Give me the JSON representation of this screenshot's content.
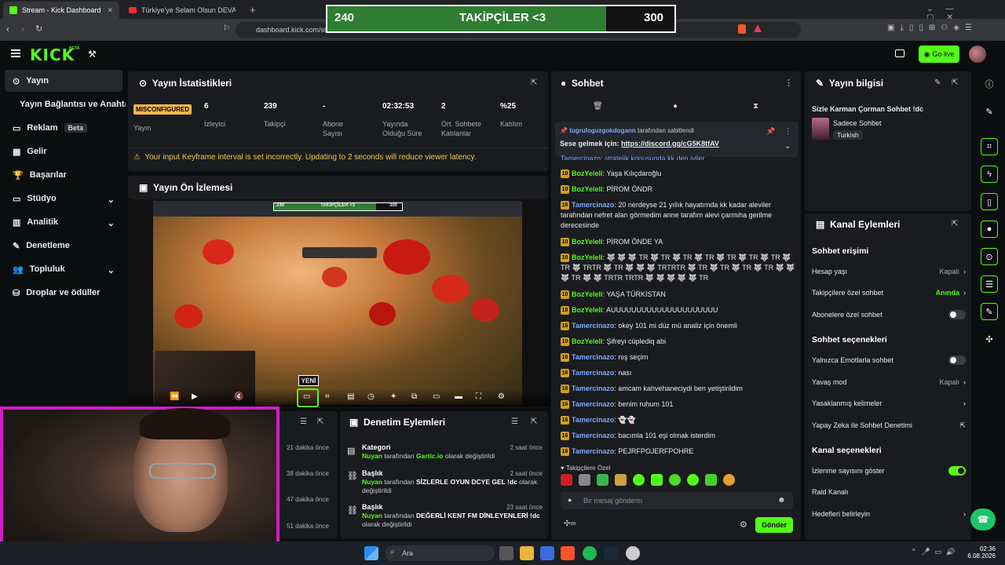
{
  "browser": {
    "tabs": [
      {
        "label": "Stream - Kick Dashboard"
      },
      {
        "label": "Türkiye'ye Selam Olsun DEVA Geliyor"
      }
    ],
    "url": "dashboard.kick.com/str"
  },
  "goal": {
    "label": "TAKİPÇİLER <3",
    "current": "240",
    "target": "300",
    "progress": 0.8
  },
  "header": {
    "logo": "KICK",
    "beta": "BETA",
    "golive": "Go live"
  },
  "sidebar": {
    "items": [
      {
        "label": "Yayın"
      },
      {
        "label": "Yayın Bağlantısı ve Anahtarı"
      },
      {
        "label": "Reklam"
      },
      {
        "label": "Gelir"
      },
      {
        "label": "Başarılar"
      },
      {
        "label": "Stüdyo"
      },
      {
        "label": "Analitik"
      },
      {
        "label": "Denetleme"
      },
      {
        "label": "Topluluk"
      },
      {
        "label": "Droplar ve ödüller"
      }
    ],
    "beta": "Beta"
  },
  "stats": {
    "title": "Yayın İstatistikleri",
    "status": "MISCONFIGURED",
    "status_label": "Yayın",
    "cells": [
      {
        "value": "6",
        "label": "İzleyici"
      },
      {
        "value": "239",
        "label": "Takipçi"
      },
      {
        "value": "-",
        "label": "Abone Sayısı"
      },
      {
        "value": "02:32:53",
        "label": "Yayında Olduğu Süre"
      },
      {
        "value": "2",
        "label": "Ort. Sohbete Katılanlar"
      },
      {
        "value": "%25",
        "label": "Katılım"
      }
    ],
    "warning": "Your input Keyframe interval is set incorrectly. Updating to 2 seconds will reduce viewer latency."
  },
  "preview": {
    "title": "Yayın Ön İzlemesi",
    "mini_goal_label": "TAKİPÇİLER <3",
    "mini_current": "240",
    "mini_target": "300",
    "new_badge": "YENİ"
  },
  "moderation": {
    "title": "Denetim Eylemleri",
    "times": [
      "21 dakika önce",
      "38 dakika önce",
      "47 dakika önce",
      "51 dakika önce"
    ],
    "items": [
      {
        "title": "Kategori",
        "user": "Nuyan",
        "pre": "tarafından",
        "value": "Gartic.io",
        "post": "olarak değiştirildi",
        "time": "2 saat önce"
      },
      {
        "title": "Başlık",
        "user": "Nuyan",
        "pre": "tarafından",
        "value": "SİZLERLE OYUN DCYE GEL !dc",
        "post": "olarak değiştirildi",
        "time": "2 saat önce"
      },
      {
        "title": "Başlık",
        "user": "Nuyan",
        "pre": "tarafından",
        "value": "DEĞERLİ KENT FM DİNLEYENLERİ !dc",
        "post": "olarak değiştirildi",
        "time": "23 saat önce"
      }
    ]
  },
  "chat": {
    "title": "Sohbet",
    "pinned_by": "tugruloguzgokdogann",
    "pinned_suffix": "tarafından sabitlendi",
    "pinned_text": "Sese gelmek için:",
    "pinned_link": "https://discord.gg/cG5K8tfAV",
    "partial": "Tamercinazo: stratejik konusunda kk den iyiler",
    "messages": [
      {
        "badge": "10",
        "user": "BozYeleli",
        "text": "Yaşa Kılıçdaroğlu"
      },
      {
        "badge": "10",
        "user": "BozYeleli",
        "text": "PİROM ÖNDR"
      },
      {
        "badge": "16",
        "user": "Tamercinazo",
        "text": "20 nerdeyse 21 yıllık hayatımda kk kadar aleviler tarafından nefret alan görmedim anne tarafım alevi çarmıha gerilme derecesinde"
      },
      {
        "badge": "10",
        "user": "BozYeleli",
        "text": "PİROM ÖNDE YA"
      },
      {
        "badge": "10",
        "user": "BozYeleli",
        "text": "🐺 🐺 🐺 TR 🐺 TR 🐺 TR 🐺 TR 🐺 TR 🐺 TR 🐺 TR 🐺 TR 🐺 TRTR 🐺 TR 🐺 🐺 🐺 TRTRTR 🐺 TR 🐺 TR 🐺 TR 🐺 TR 🐺 🐺 🐺 TR 🐺 🐺 TRTR TRTR 🐺 🐺 🐺 🐺 🐺 TR"
      },
      {
        "badge": "10",
        "user": "BozYeleli",
        "text": "YAŞA TÜRKİSTAN"
      },
      {
        "badge": "10",
        "user": "BozYeleli",
        "text": "AUUUUUUUUUUUUUUUUUUUUU"
      },
      {
        "badge": "16",
        "user": "Tamercinazo",
        "text": "okey 101 mi düz mü analiz için önemli"
      },
      {
        "badge": "10",
        "user": "BozYeleli",
        "text": "Şifreyi cüplediq abi"
      },
      {
        "badge": "16",
        "user": "Tamercinazo",
        "text": "nış seçim"
      },
      {
        "badge": "16",
        "user": "Tamercinazo",
        "text": "nası"
      },
      {
        "badge": "16",
        "user": "Tamercinazo",
        "text": "amcam kahvehaneciydi ben yetiştirildim"
      },
      {
        "badge": "16",
        "user": "Tamercinazo",
        "text": "benim ruhum 101"
      },
      {
        "badge": "16",
        "user": "Tamercinazo",
        "text": "👻👻"
      },
      {
        "badge": "16",
        "user": "Tamercinazo",
        "text": "bacımla 101 eşi olmak isterdim"
      },
      {
        "badge": "16",
        "user": "Tamercinazo",
        "text": "PEJRFPOJERFPOHRE"
      }
    ],
    "followers_only": "Takipçilere Özel",
    "placeholder": "Bir mesaj gönderin",
    "send": "Gönder"
  },
  "info": {
    "title": "Yayın bilgisi",
    "stream_title": "Sizle Karman Çorman Sohbet !dc",
    "category": "Sadece Sohbet",
    "language": "Turkish"
  },
  "channel": {
    "title": "Kanal Eylemleri",
    "chat_access": "Sohbet erişimi",
    "age_label": "Hesap yaşı",
    "age_value": "Kapalı",
    "fol_label": "Takipçilere özel sohbet",
    "fol_value": "Anında",
    "sub_label": "Abonelere özel sohbet",
    "chat_opts": "Sohbet seçenekleri",
    "emote_label": "Yalnızca Emotlarla sohbet",
    "slow_label": "Yavaş mod",
    "slow_value": "Kapalı",
    "banned_label": "Yasaklanmış kelimeler",
    "ai_label": "Yapay Zeka ile Sohbet Denetimi",
    "channel_opts": "Kanal seçenekleri",
    "viewers_label": "İzlenme sayısını göster",
    "raid_label": "Raid Kanalı",
    "targets_label": "Hedefleri belirleyin"
  },
  "taskbar": {
    "search": "Ara",
    "time": "02:36",
    "date": "6.08.2026"
  },
  "colors": {
    "accent": "#53fc18",
    "bg": "#0b0e0f",
    "panel": "#191b1f",
    "warning": "#f2c94c",
    "facecam_border": "#d21cc7"
  }
}
